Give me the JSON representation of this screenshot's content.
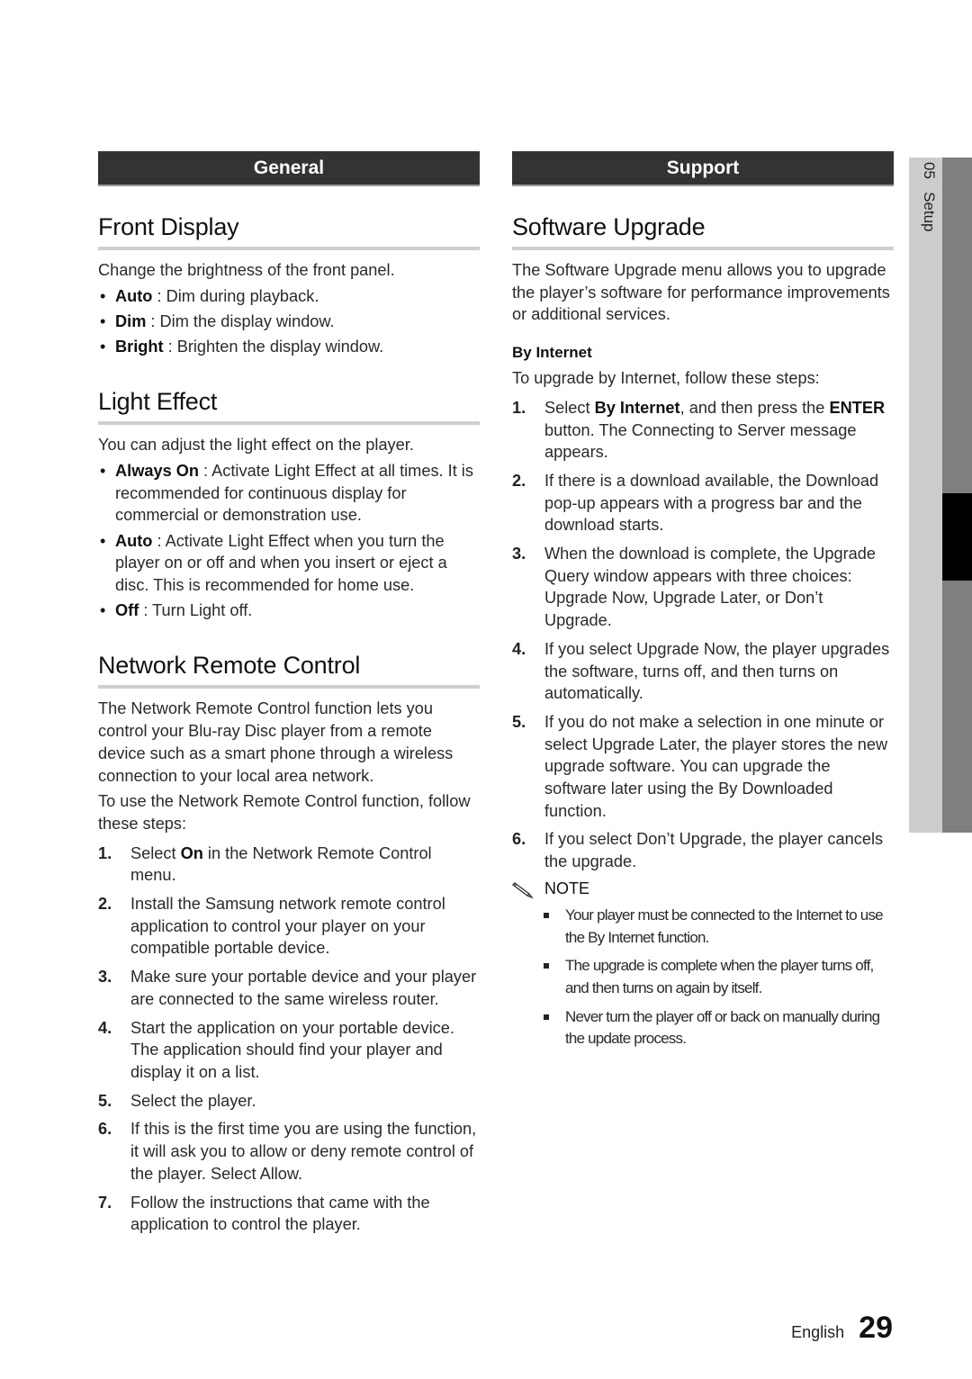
{
  "side_tab": {
    "label": "05   Setup"
  },
  "left": {
    "section": "General",
    "front_display": {
      "title": "Front Display",
      "intro": "Change the brightness of the front panel.",
      "items": [
        {
          "term": "Auto",
          "desc": " : Dim during playback."
        },
        {
          "term": "Dim",
          "desc": " : Dim the display window."
        },
        {
          "term": "Bright",
          "desc": " : Brighten the display window."
        }
      ]
    },
    "light_effect": {
      "title": "Light Effect",
      "intro": "You can adjust the light effect on the player.",
      "items": [
        {
          "term": "Always On",
          "desc": " : Activate Light Effect at all times. It is recommended for continuous display for commercial or demonstration use."
        },
        {
          "term": "Auto",
          "desc": " : Activate Light Effect when you turn the player on or off and when you insert or eject a disc. This is recommended for home use."
        },
        {
          "term": "Off",
          "desc": " : Turn Light off."
        }
      ]
    },
    "network_remote": {
      "title": "Network Remote Control",
      "intro": "The Network Remote Control function lets you control your Blu-ray Disc player from a remote device such as a smart phone through a wireless connection to your local area network.",
      "intro2": "To use the Network Remote Control function, follow these steps:",
      "steps": [
        {
          "num": "1.",
          "pre": "Select ",
          "bold": "On",
          "post": " in the Network Remote Control menu."
        },
        {
          "num": "2.",
          "pre": "Install the Samsung network remote control application to control your player on your compatible portable device.",
          "bold": "",
          "post": ""
        },
        {
          "num": "3.",
          "pre": "Make sure your portable device and your player are connected to the same wireless router.",
          "bold": "",
          "post": ""
        },
        {
          "num": "4.",
          "pre": "Start the application on your portable device. The application should find your player and display it on a list.",
          "bold": "",
          "post": ""
        },
        {
          "num": "5.",
          "pre": "Select the player.",
          "bold": "",
          "post": ""
        },
        {
          "num": "6.",
          "pre": "If this is the first time you are using the function, it will ask you to allow or deny remote control of the player. Select Allow.",
          "bold": "",
          "post": ""
        },
        {
          "num": "7.",
          "pre": "Follow the instructions that came with the application to control the player.",
          "bold": "",
          "post": ""
        }
      ]
    }
  },
  "right": {
    "section": "Support",
    "software_upgrade": {
      "title": "Software Upgrade",
      "intro": "The Software Upgrade menu allows you to upgrade the player’s software for performance improvements or additional services.",
      "sub_heading": "By Internet",
      "sub_intro": "To upgrade by Internet, follow these steps:",
      "step1": {
        "num": "1.",
        "pre": "Select ",
        "bold1": "By Internet",
        "mid": ", and then press the ",
        "bold2": "ENTER",
        "post": " button. The Connecting to Server message appears."
      },
      "steps": [
        {
          "num": "2.",
          "text": "If there is a download available, the Download pop-up appears with a progress bar and the download starts."
        },
        {
          "num": "3.",
          "text": "When the download is complete, the Upgrade Query window appears with three choices: Upgrade Now, Upgrade Later, or Don’t Upgrade."
        },
        {
          "num": "4.",
          "text": "If you select Upgrade Now, the player upgrades the software, turns off, and then turns on automatically."
        },
        {
          "num": "5.",
          "text": "If you do not make a selection in one minute or select Upgrade Later, the player stores the new upgrade software. You can upgrade the software later using the By Downloaded function."
        },
        {
          "num": "6.",
          "text": "If you select Don’t Upgrade, the player cancels the upgrade."
        }
      ],
      "note_label": "NOTE",
      "notes": [
        "Your player must be connected to the Internet to use the By Internet function.",
        "The upgrade is complete when the player turns off, and then turns on again by itself.",
        "Never turn the player off or back on manually during the update process."
      ]
    }
  },
  "footer": {
    "language": "English",
    "page_number": "29"
  }
}
